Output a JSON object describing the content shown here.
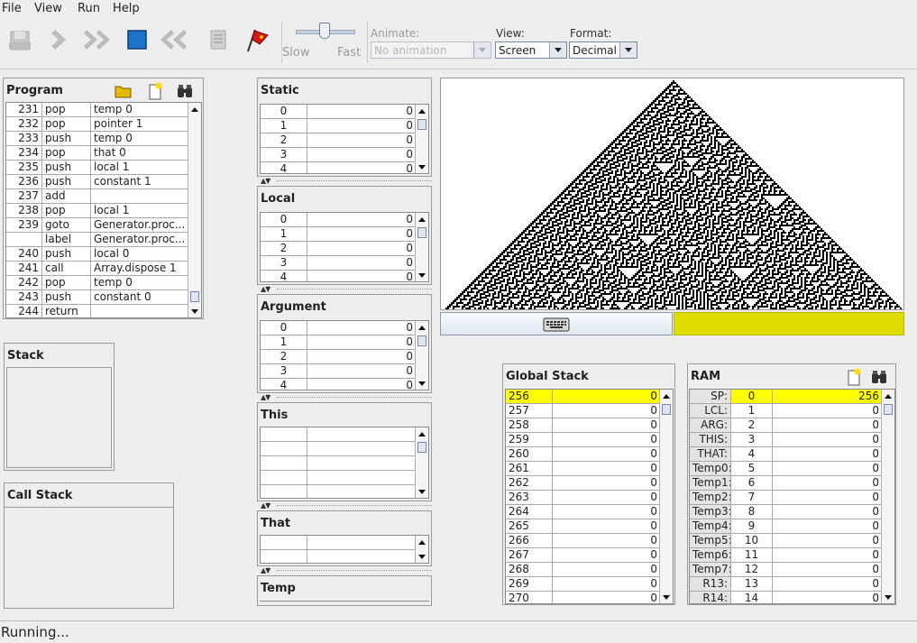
{
  "menu": {
    "file": "File",
    "view": "View",
    "run": "Run",
    "help": "Help"
  },
  "toolbar": {
    "speed_slow": "Slow",
    "speed_fast": "Fast",
    "animate_label": "Animate:",
    "animate_value": "No animation",
    "view_label": "View:",
    "view_value": "Screen",
    "format_label": "Format:",
    "format_value": "Decimal"
  },
  "program": {
    "title": "Program",
    "rows": [
      {
        "line": "231",
        "cmd": "pop",
        "arg": "temp 0"
      },
      {
        "line": "232",
        "cmd": "pop",
        "arg": "pointer 1"
      },
      {
        "line": "233",
        "cmd": "push",
        "arg": "temp 0"
      },
      {
        "line": "234",
        "cmd": "pop",
        "arg": "that 0"
      },
      {
        "line": "235",
        "cmd": "push",
        "arg": "local 1"
      },
      {
        "line": "236",
        "cmd": "push",
        "arg": "constant 1"
      },
      {
        "line": "237",
        "cmd": "add",
        "arg": ""
      },
      {
        "line": "238",
        "cmd": "pop",
        "arg": "local 1"
      },
      {
        "line": "239",
        "cmd": "goto",
        "arg": "Generator.proc..."
      },
      {
        "line": "",
        "cmd": "label",
        "arg": "Generator.proc..."
      },
      {
        "line": "240",
        "cmd": "push",
        "arg": "local 0"
      },
      {
        "line": "241",
        "cmd": "call",
        "arg": "Array.dispose 1"
      },
      {
        "line": "242",
        "cmd": "pop",
        "arg": "temp 0"
      },
      {
        "line": "243",
        "cmd": "push",
        "arg": "constant 0"
      },
      {
        "line": "244",
        "cmd": "return",
        "arg": ""
      }
    ]
  },
  "stack": {
    "title": "Stack"
  },
  "call_stack": {
    "title": "Call Stack"
  },
  "segments": {
    "static": {
      "title": "Static",
      "rows": [
        [
          "0",
          "0"
        ],
        [
          "1",
          "0"
        ],
        [
          "2",
          "0"
        ],
        [
          "3",
          "0"
        ],
        [
          "4",
          "0"
        ]
      ]
    },
    "local": {
      "title": "Local",
      "rows": [
        [
          "0",
          "0"
        ],
        [
          "1",
          "0"
        ],
        [
          "2",
          "0"
        ],
        [
          "3",
          "0"
        ],
        [
          "4",
          "0"
        ]
      ]
    },
    "argument": {
      "title": "Argument",
      "rows": [
        [
          "0",
          "0"
        ],
        [
          "1",
          "0"
        ],
        [
          "2",
          "0"
        ],
        [
          "3",
          "0"
        ],
        [
          "4",
          "0"
        ]
      ]
    },
    "this": {
      "title": "This"
    },
    "that": {
      "title": "That"
    },
    "temp": {
      "title": "Temp"
    }
  },
  "global_stack": {
    "title": "Global Stack",
    "rows": [
      [
        "256",
        "0"
      ],
      [
        "257",
        "0"
      ],
      [
        "258",
        "0"
      ],
      [
        "259",
        "0"
      ],
      [
        "260",
        "0"
      ],
      [
        "261",
        "0"
      ],
      [
        "262",
        "0"
      ],
      [
        "263",
        "0"
      ],
      [
        "264",
        "0"
      ],
      [
        "265",
        "0"
      ],
      [
        "266",
        "0"
      ],
      [
        "267",
        "0"
      ],
      [
        "268",
        "0"
      ],
      [
        "269",
        "0"
      ],
      [
        "270",
        "0"
      ]
    ]
  },
  "ram": {
    "title": "RAM",
    "rows": [
      [
        "SP:",
        "0",
        "256"
      ],
      [
        "LCL:",
        "1",
        "0"
      ],
      [
        "ARG:",
        "2",
        "0"
      ],
      [
        "THIS:",
        "3",
        "0"
      ],
      [
        "THAT:",
        "4",
        "0"
      ],
      [
        "Temp0:",
        "5",
        "0"
      ],
      [
        "Temp1:",
        "6",
        "0"
      ],
      [
        "Temp2:",
        "7",
        "0"
      ],
      [
        "Temp3:",
        "8",
        "0"
      ],
      [
        "Temp4:",
        "9",
        "0"
      ],
      [
        "Temp5:",
        "10",
        "0"
      ],
      [
        "Temp6:",
        "11",
        "0"
      ],
      [
        "Temp7:",
        "12",
        "0"
      ],
      [
        "R13:",
        "13",
        "0"
      ],
      [
        "R14:",
        "14",
        "0"
      ]
    ]
  },
  "status": {
    "text": "Running..."
  },
  "colors": {
    "highlight": "#ffff00",
    "keyboard_bar": "#dddd00"
  }
}
